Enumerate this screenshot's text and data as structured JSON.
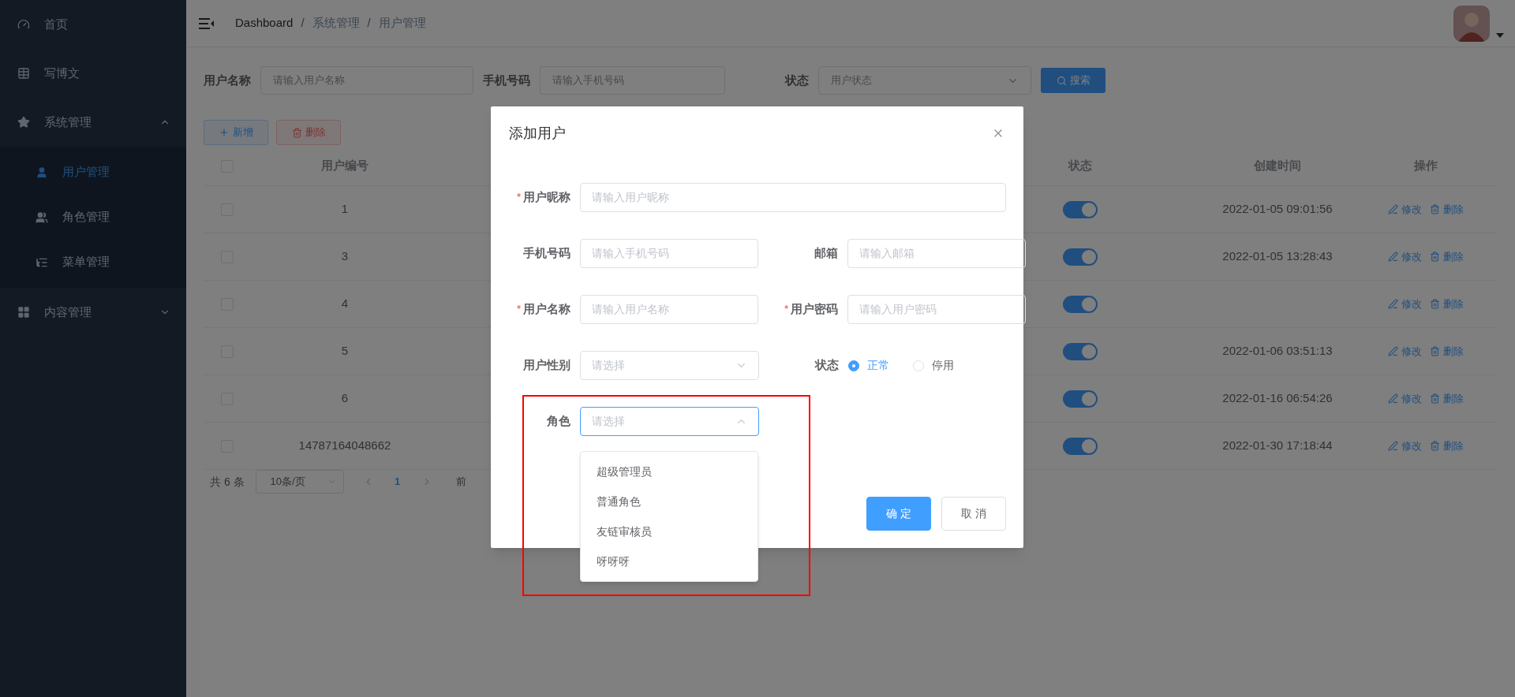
{
  "sidebar": {
    "items": [
      {
        "label": "首页",
        "selected": false
      },
      {
        "label": "写博文",
        "selected": false
      },
      {
        "label": "系统管理",
        "expanded": true,
        "children": [
          {
            "label": "用户管理",
            "selected": true
          },
          {
            "label": "角色管理",
            "selected": false
          },
          {
            "label": "菜单管理",
            "selected": false
          }
        ]
      },
      {
        "label": "内容管理",
        "expanded": false
      }
    ]
  },
  "breadcrumb": [
    {
      "label": "Dashboard"
    },
    {
      "separator": "/",
      "label": "系统管理"
    },
    {
      "separator": "/",
      "label": "用户管理"
    }
  ],
  "search": {
    "fields": [
      {
        "label": "用户名称",
        "kind": "input",
        "placeholder": "请输入用户名称"
      },
      {
        "label": "手机号码",
        "kind": "input",
        "placeholder": "请输入手机号码"
      },
      {
        "label": "状态",
        "kind": "select",
        "placeholder": "用户状态"
      }
    ],
    "button": "搜索"
  },
  "toolbar": {
    "add": "新增",
    "delete": "删除"
  },
  "table": {
    "select_all": {
      "checked": false
    },
    "columns": [
      "用户编号",
      "状态",
      "创建时间",
      "操作"
    ],
    "rows": [
      {
        "checked": false,
        "id": "1",
        "on": true,
        "created": "2022-01-05 09:01:56",
        "actions": [
          "修改",
          "删除"
        ]
      },
      {
        "checked": false,
        "id": "3",
        "on": true,
        "created": "2022-01-05 13:28:43",
        "actions": [
          "修改",
          "删除"
        ]
      },
      {
        "checked": false,
        "id": "4",
        "on": true,
        "actions": [
          "修改",
          "删除"
        ]
      },
      {
        "checked": false,
        "id": "5",
        "on": true,
        "created": "2022-01-06 03:51:13",
        "actions": [
          "修改",
          "删除"
        ]
      },
      {
        "checked": false,
        "id": "6",
        "on": true,
        "created": "2022-01-16 06:54:26",
        "actions": [
          "修改",
          "删除"
        ]
      },
      {
        "checked": false,
        "id": "14787164048662",
        "on": true,
        "created": "2022-01-30 17:18:44",
        "actions": [
          "修改",
          "删除"
        ]
      }
    ]
  },
  "pagination": {
    "total": "共 6 条",
    "page_size": "10条/页",
    "pages": [
      {
        "label": "1",
        "selected": true
      }
    ],
    "jump_label": "前"
  },
  "dialog": {
    "title": "添加用户",
    "rows": [
      {
        "fields": [
          {
            "kind": "input",
            "label": "用户昵称",
            "required_mark": "*",
            "placeholder": "请输入用户昵称"
          }
        ]
      },
      {
        "fields": [
          {
            "kind": "input",
            "label": "手机号码",
            "placeholder": "请输入手机号码"
          },
          {
            "kind": "input",
            "label": "邮箱",
            "placeholder": "请输入邮箱"
          }
        ]
      },
      {
        "fields": [
          {
            "kind": "input",
            "label": "用户名称",
            "required_mark": "*",
            "placeholder": "请输入用户名称"
          },
          {
            "kind": "input",
            "label": "用户密码",
            "required_mark": "*",
            "placeholder": "请输入用户密码"
          }
        ]
      },
      {
        "fields": [
          {
            "kind": "select",
            "label": "用户性别",
            "placeholder": "请选择",
            "open": false
          },
          {
            "kind": "radio",
            "label": "状态",
            "options": [
              {
                "label": "正常",
                "selected": true
              },
              {
                "label": "停用",
                "selected": false
              }
            ]
          }
        ]
      },
      {
        "fields": [
          {
            "kind": "select",
            "label": "角色",
            "placeholder": "请选择",
            "open": true,
            "options": [
              {
                "label": "超级管理员"
              },
              {
                "label": "普通角色"
              },
              {
                "label": "友链审核员"
              },
              {
                "label": "呀呀呀"
              }
            ]
          }
        ]
      }
    ],
    "buttons": [
      {
        "label": "确 定",
        "kind": "primary"
      },
      {
        "label": "取 消",
        "kind": "default"
      }
    ]
  }
}
